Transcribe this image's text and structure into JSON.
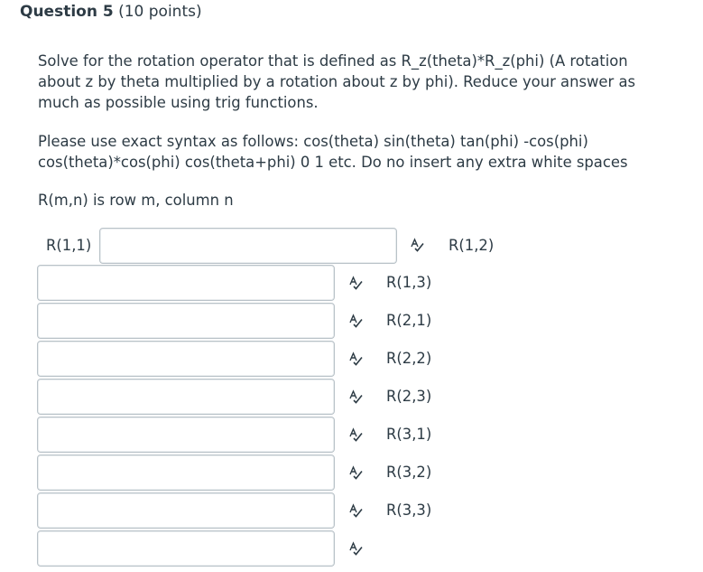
{
  "question": {
    "title": "Question 5",
    "points": "(10 points)"
  },
  "prompt": {
    "para1_line1": "Solve for the rotation operator that is defined as R_z(theta)*R_z(phi) (A rotation",
    "para1_line2": "about z by theta multiplied by a rotation about z by phi). Reduce your answer as",
    "para1_line3": "much as possible using trig functions.",
    "para2_line1": "Please use exact syntax as follows: cos(theta) sin(theta) tan(phi) -cos(phi)",
    "para2_line2": "cos(theta)*cos(phi)  cos(theta+phi) 0 1 etc. Do no insert any extra white spaces",
    "para3": "R(m,n) is row m, column n"
  },
  "answers": {
    "r11": {
      "label": "R(1,1)",
      "value": ""
    },
    "r12": {
      "label": "R(1,2)",
      "value": ""
    },
    "r13": {
      "label": "R(1,3)",
      "value": ""
    },
    "r21": {
      "label": "R(2,1)",
      "value": ""
    },
    "r22": {
      "label": "R(2,2)",
      "value": ""
    },
    "r23": {
      "label": "R(2,3)",
      "value": ""
    },
    "r31": {
      "label": "R(3,1)",
      "value": ""
    },
    "r32": {
      "label": "R(3,2)",
      "value": ""
    },
    "r33": {
      "label": "R(3,3)",
      "value": ""
    }
  },
  "icons": {
    "spellcheck": "spellcheck-icon"
  },
  "colors": {
    "text": "#2d3b45",
    "border": "#b9c2c8"
  }
}
